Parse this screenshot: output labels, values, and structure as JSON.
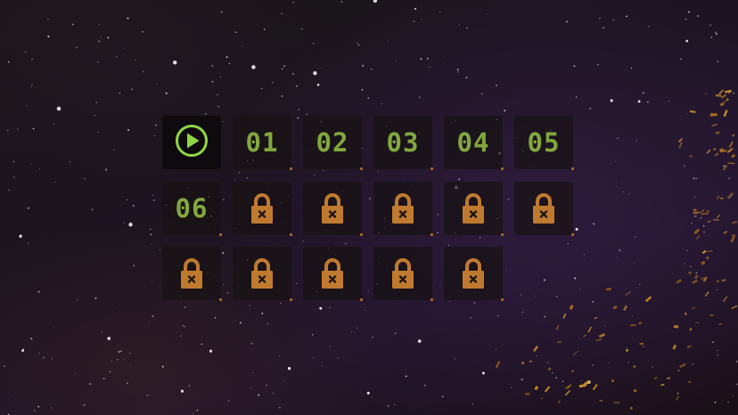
{
  "colors": {
    "level_number": "#82a83e",
    "play_icon": "#8ed646",
    "lock_icon": "#c07a30",
    "tile_bg": "#181214",
    "background": "#1c1420"
  },
  "level_select": {
    "play_tile": {
      "icon": "play-icon",
      "state": "current"
    },
    "unlocked_levels": [
      {
        "number": "01"
      },
      {
        "number": "02"
      },
      {
        "number": "03"
      },
      {
        "number": "04"
      },
      {
        "number": "05"
      },
      {
        "number": "06"
      }
    ],
    "locked_levels": [
      {
        "icon": "lock-icon"
      },
      {
        "icon": "lock-icon"
      },
      {
        "icon": "lock-icon"
      },
      {
        "icon": "lock-icon"
      },
      {
        "icon": "lock-icon"
      },
      {
        "icon": "lock-icon"
      },
      {
        "icon": "lock-icon"
      },
      {
        "icon": "lock-icon"
      },
      {
        "icon": "lock-icon"
      },
      {
        "icon": "lock-icon"
      }
    ]
  }
}
